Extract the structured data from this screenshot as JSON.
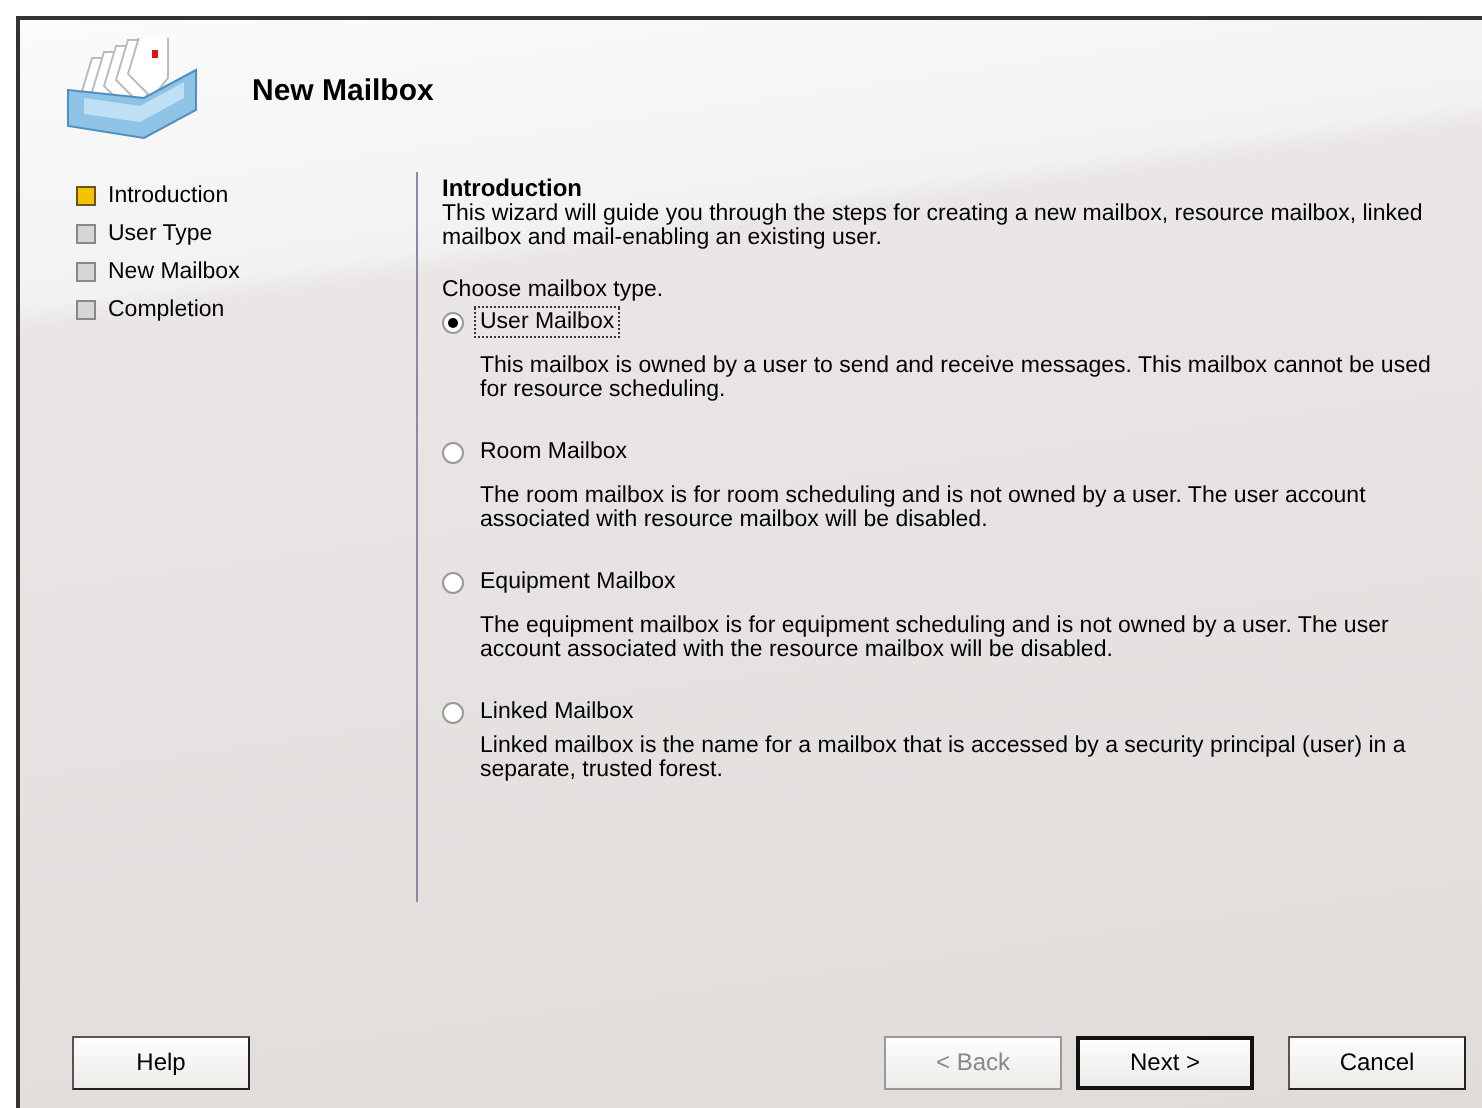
{
  "window": {
    "title": "New Mailbox"
  },
  "steps": [
    {
      "label": "Introduction",
      "selected": true
    },
    {
      "label": "User Type",
      "selected": false
    },
    {
      "label": "New Mailbox",
      "selected": false
    },
    {
      "label": "Completion",
      "selected": false
    }
  ],
  "content": {
    "heading": "Introduction",
    "intro": "This wizard will guide you through the steps for creating a new mailbox, resource mailbox, linked mailbox and mail-enabling an existing user.",
    "prompt": "Choose mailbox type.",
    "options": [
      {
        "label": "User Mailbox",
        "selected": true,
        "description": "This mailbox is owned by a user to send and receive messages. This mailbox cannot be used for resource scheduling."
      },
      {
        "label": "Room Mailbox",
        "selected": false,
        "description": "The room mailbox is for room scheduling and is not owned by a user. The user account associated with resource mailbox will be disabled."
      },
      {
        "label": "Equipment Mailbox",
        "selected": false,
        "description": "The equipment mailbox is for equipment scheduling and is not owned by a user. The user account associated with the resource mailbox will be disabled."
      },
      {
        "label": "Linked Mailbox",
        "selected": false,
        "description": "Linked mailbox is the name for a mailbox that is accessed by a security principal (user) in a separate, trusted forest."
      }
    ]
  },
  "buttons": [
    {
      "label": "Help",
      "kind": "help",
      "disabled": false,
      "default": false
    },
    {
      "label": "< Back",
      "kind": "nav",
      "disabled": true,
      "default": false
    },
    {
      "label": "Next >",
      "kind": "nav",
      "disabled": false,
      "default": true
    },
    {
      "label": "Cancel",
      "kind": "nav",
      "disabled": false,
      "default": false
    }
  ]
}
